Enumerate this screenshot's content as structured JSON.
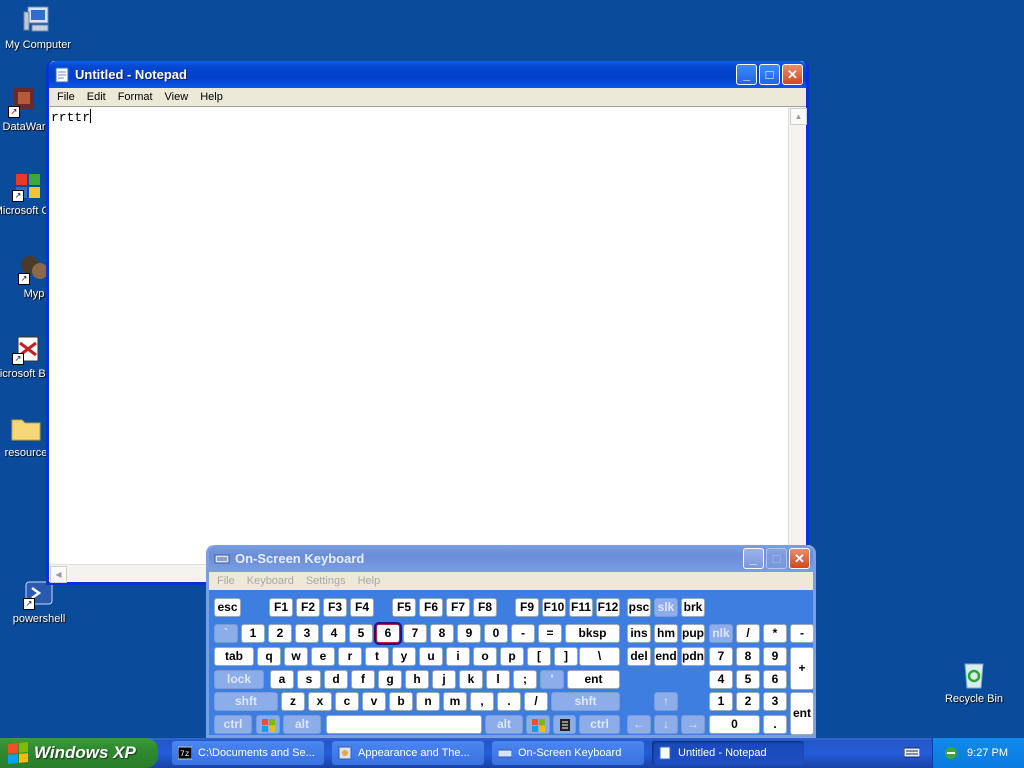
{
  "desktop": {
    "icons": [
      {
        "label": "My Computer",
        "icon": "my-computer-icon"
      },
      {
        "label": "DataWar",
        "icon": "shortcut-icon"
      },
      {
        "label": "Microsoft C++",
        "icon": "shortcut-icon"
      },
      {
        "label": "Myp",
        "icon": "shortcut-icon"
      },
      {
        "label": "Microsoft Basic",
        "icon": "shortcut-icon"
      },
      {
        "label": "resource",
        "icon": "folder-icon"
      },
      {
        "label": "powershell",
        "icon": "powershell-icon"
      },
      {
        "label": "Recycle Bin",
        "icon": "recycle-bin-icon"
      }
    ]
  },
  "notepad": {
    "title": "Untitled - Notepad",
    "menu": [
      "File",
      "Edit",
      "Format",
      "View",
      "Help"
    ],
    "text": "rrttr"
  },
  "osk": {
    "title": "On-Screen Keyboard",
    "menu": [
      "File",
      "Keyboard",
      "Settings",
      "Help"
    ],
    "keys": {
      "row1": [
        "esc",
        "F1",
        "F2",
        "F3",
        "F4",
        "F5",
        "F6",
        "F7",
        "F8",
        "F9",
        "F10",
        "F11",
        "F12",
        "psc",
        "slk",
        "brk"
      ],
      "row2": [
        "`",
        "1",
        "2",
        "3",
        "4",
        "5",
        "6",
        "7",
        "8",
        "9",
        "0",
        "-",
        "=",
        "bksp",
        "ins",
        "hm",
        "pup",
        "nlk",
        "/",
        "*",
        "-"
      ],
      "row3": [
        "tab",
        "q",
        "w",
        "e",
        "r",
        "t",
        "y",
        "u",
        "i",
        "o",
        "p",
        "[",
        "]",
        "\\",
        "del",
        "end",
        "pdn",
        "7",
        "8",
        "9",
        "+"
      ],
      "row4": [
        "lock",
        "a",
        "s",
        "d",
        "f",
        "g",
        "h",
        "j",
        "k",
        "l",
        ";",
        "'",
        "ent",
        "4",
        "5",
        "6"
      ],
      "row5": [
        "shft",
        "z",
        "x",
        "c",
        "v",
        "b",
        "n",
        "m",
        ",",
        ".",
        "/",
        "shft",
        "1",
        "2",
        "3",
        "ent"
      ],
      "row6": [
        "ctrl",
        "alt",
        "alt",
        "ctrl",
        "0",
        "."
      ]
    },
    "highlighted_key": "6"
  },
  "taskbar": {
    "start_label": "Windows XP",
    "tasks": [
      {
        "label": "C:\\Documents and Se...",
        "active": false
      },
      {
        "label": "Appearance and The...",
        "active": false
      },
      {
        "label": "On-Screen Keyboard",
        "active": false
      },
      {
        "label": "Untitled - Notepad",
        "active": true
      }
    ],
    "clock": "9:27 PM"
  }
}
